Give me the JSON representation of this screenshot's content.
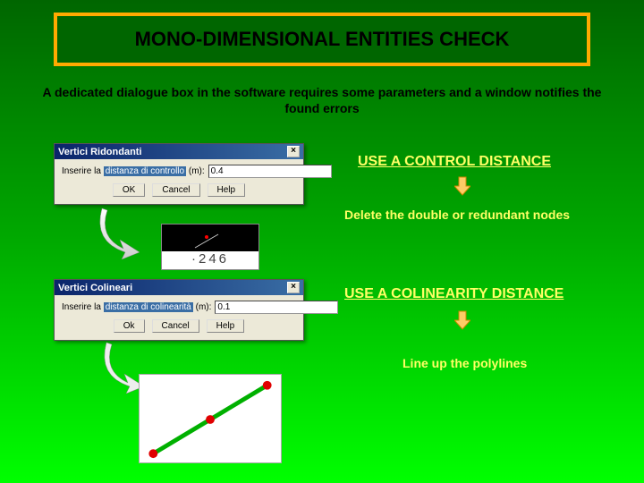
{
  "title": "MONO-DIMENSIONAL ENTITIES CHECK",
  "intro": "A dedicated dialogue box in the software requires some parameters and a window notifies the found errors",
  "dialog1": {
    "title": "Vertici Ridondanti",
    "label_prefix": "Inserire la",
    "label_hl": "distanza di controllo",
    "label_suffix": "(m):",
    "value": "0.4",
    "ok": "OK",
    "cancel": "Cancel",
    "help": "Help"
  },
  "dialog2": {
    "title": "Vertici Colineari",
    "label_prefix": "Inserire la",
    "label_hl": "distanza di colinearità",
    "label_suffix": "(m):",
    "value": "0.1",
    "ok": "Ok",
    "cancel": "Cancel",
    "help": "Help"
  },
  "minimap_label": "·246",
  "section1": {
    "heading": "USE A CONTROL DISTANCE",
    "desc": "Delete the double or redundant nodes"
  },
  "section2": {
    "heading": "USE A COLINEARITY DISTANCE",
    "desc": "Line up the polylines"
  }
}
